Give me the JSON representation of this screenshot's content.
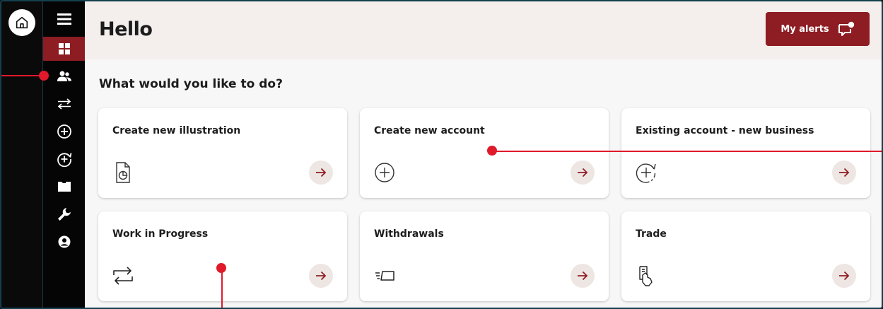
{
  "header": {
    "title": "Hello",
    "alerts_label": "My alerts"
  },
  "main": {
    "question": "What would you like to do?"
  },
  "cards": [
    {
      "label": "Create new illustration",
      "icon": "illustration-document-icon"
    },
    {
      "label": "Create new account",
      "icon": "plus-circle-icon"
    },
    {
      "label": "Existing account - new business",
      "icon": "plus-circle-refresh-icon"
    },
    {
      "label": "Work in Progress",
      "icon": "repeat-arrows-icon"
    },
    {
      "label": "Withdrawals",
      "icon": "withdrawal-card-icon"
    },
    {
      "label": "Trade",
      "icon": "trade-hand-icon"
    }
  ],
  "sidebar": {
    "items": [
      "dashboard-icon",
      "people-icon",
      "transfer-arrows-icon",
      "add-circle-icon",
      "add-refresh-icon",
      "folder-icon",
      "wrench-icon",
      "user-circle-icon"
    ],
    "active_index": 0
  },
  "colors": {
    "brand": "#8e1d23",
    "arrow_bg": "#ede6e3",
    "annotation": "#e0192b"
  }
}
